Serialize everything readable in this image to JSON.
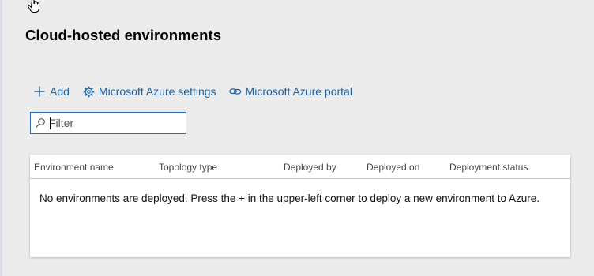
{
  "page": {
    "title": "Cloud-hosted environments"
  },
  "toolbar": {
    "add_label": "Add",
    "settings_label": "Microsoft Azure settings",
    "portal_label": "Microsoft Azure portal"
  },
  "filter": {
    "placeholder": "Filter",
    "value": ""
  },
  "grid": {
    "columns": [
      "Environment name",
      "Topology type",
      "Deployed by",
      "Deployed on",
      "Deployment status"
    ],
    "empty_message": "No environments are deployed. Press the + in the upper-left corner to deploy a new environment to Azure."
  },
  "icons": {
    "add": "plus-icon",
    "settings": "gear-icon",
    "portal": "link-icon",
    "filter": "search-icon",
    "cursor": "hand-pointer-icon"
  },
  "colors": {
    "background": "#ebebeb",
    "link": "#1f5f9f",
    "filter_border": "#2b6ca8"
  }
}
